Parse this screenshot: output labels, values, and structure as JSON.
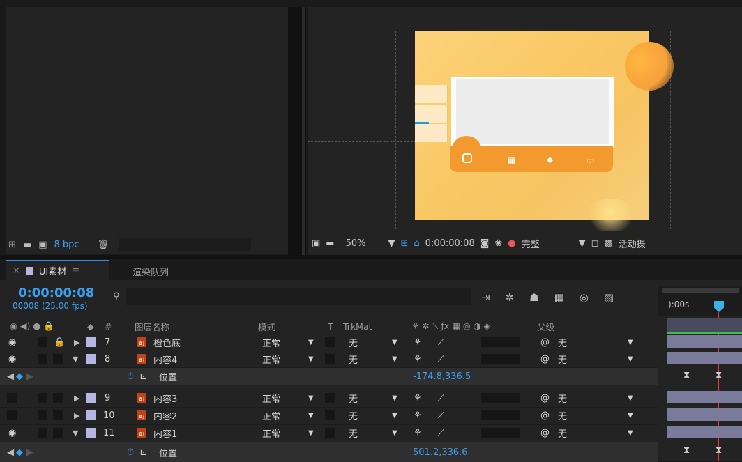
{
  "project": {
    "bpc_label": "8 bpc"
  },
  "viewer": {
    "zoom": "50%",
    "timecode": "0:00:00:08",
    "quality": "完整",
    "view_label": "活动摄"
  },
  "tabs": [
    {
      "label": "UI素材",
      "active": true,
      "menu": "≡",
      "close": "×"
    },
    {
      "label": "渲染队列",
      "active": false
    }
  ],
  "timeline": {
    "timecode": "0:00:00:08",
    "fps": "00008 (25.00 fps)",
    "ruler_label": "):00s",
    "headers": {
      "num": "#",
      "name": "图层名称",
      "mode": "模式",
      "t": "T",
      "trkmat": "TrkMat",
      "parent": "父级"
    },
    "layers": [
      {
        "num": "7",
        "name": "橙色底",
        "mode": "正常",
        "trkmat": "无",
        "parent": "无",
        "eye": true,
        "locked": true,
        "expanded": false
      },
      {
        "num": "8",
        "name": "内容4",
        "mode": "正常",
        "trkmat": "无",
        "parent": "无",
        "eye": true,
        "locked": false,
        "expanded": true,
        "prop": {
          "label": "位置",
          "value": "-174.8,336.5"
        }
      },
      {
        "num": "9",
        "name": "内容3",
        "mode": "正常",
        "trkmat": "无",
        "parent": "无",
        "eye": false,
        "locked": false,
        "expanded": false
      },
      {
        "num": "10",
        "name": "内容2",
        "mode": "正常",
        "trkmat": "无",
        "parent": "无",
        "eye": false,
        "locked": false,
        "expanded": false
      },
      {
        "num": "11",
        "name": "内容1",
        "mode": "正常",
        "trkmat": "无",
        "parent": "无",
        "eye": true,
        "locked": false,
        "expanded": true,
        "prop": {
          "label": "位置",
          "value": "501.2,336.6"
        }
      }
    ]
  },
  "colors": {
    "accent": "#3aa0f0",
    "label_lavender": "#b7b5e4",
    "ai_icon": "#c1411b",
    "cti": "#e83b3b",
    "comp_orange": "#f29a2e"
  }
}
